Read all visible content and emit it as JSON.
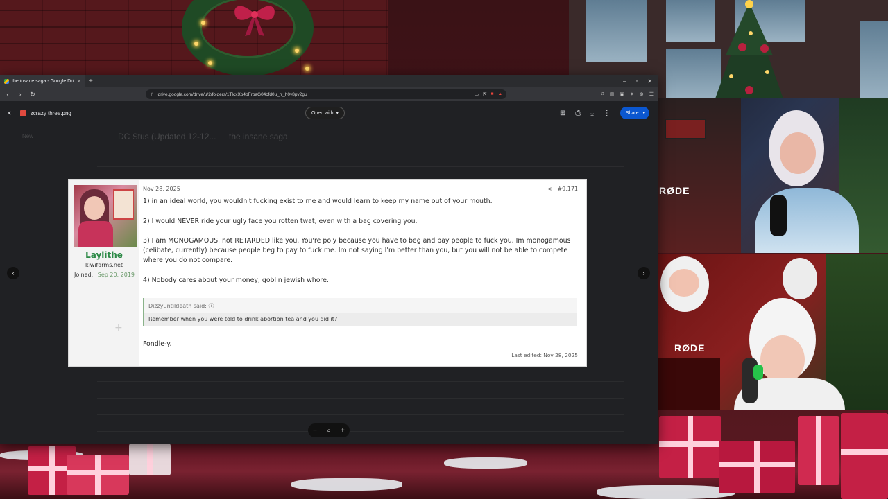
{
  "browser": {
    "tab_title": "the insane saga - Google Drive",
    "tab_close": "×",
    "new_tab": "+",
    "window_controls": [
      "–",
      "▫",
      "✕"
    ],
    "url": "drive.google.com/drive/u/2/folders/1TlcxXp4bFrbaG04cfd0u_rr_h0v8pv2gu"
  },
  "viewer": {
    "close": "✕",
    "file_name": "zcrazy three.png",
    "open_with": "Open with",
    "share": "Share"
  },
  "drive_dim": {
    "breadcrumb_1": "DC Stus (Updated 12-12...",
    "breadcrumb_2": "the insane saga",
    "new": "New"
  },
  "post": {
    "date": "Nov 28, 2025",
    "post_number": "#9,171",
    "username": "Laylithe",
    "user_title": "kiwifarms.net",
    "joined_label": "Joined:",
    "joined_date": "Sep 20, 2019",
    "paragraphs": [
      "1) in an ideal world, you wouldn't fucking exist to me and would learn to keep my name out of your mouth.",
      "2) I would NEVER ride your ugly face you rotten twat, even with a bag covering you.",
      "3) I am MONOGAMOUS, not RETARDED like you. You're poly because you have to beg and pay people to fuck you. Im monogamous (celibate, currently) because people beg to pay to fuck me. Im not saying I'm better than you, but you will not be able to compete where you do not compare.",
      "4) Nobody cares about your money, goblin jewish whore."
    ],
    "quote_author": "Dizzyuntildeath said:",
    "quote_text": "Remember when you were told to drink abortion tea and you did it?",
    "closing": "Fondle-y.",
    "last_edited": "Last edited: Nov 28, 2025"
  },
  "overlay": {
    "mic_brand_top": "RØDE",
    "mic_brand_bottom": "RØDE"
  },
  "colors": {
    "share_blue": "#0b57d0",
    "username_green": "#2d8a47"
  }
}
